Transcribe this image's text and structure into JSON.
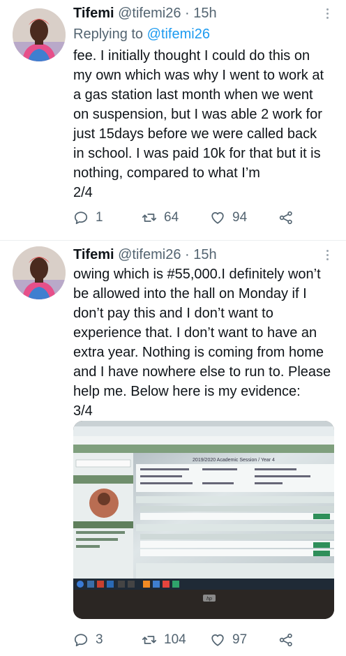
{
  "tweets": [
    {
      "author_name": "Tifemi",
      "handle": "@tifemi26",
      "separator": "·",
      "time": "15h",
      "reply_prefix": "Replying to",
      "reply_to": "@tifemi26",
      "text": "fee. I initially thought I could do this on\nmy own which was why I went to work at\na gas station last month when we went\non suspension, but I was able 2 work for\njust 15days before we were called back\nin school. I was paid 10k for that but it is\nnothing, compared to what I’m\n2/4",
      "reply_count": "1",
      "retweet_count": "64",
      "like_count": "94"
    },
    {
      "author_name": "Tifemi",
      "handle": "@tifemi26",
      "separator": "·",
      "time": "15h",
      "text": "owing which is #55,000.I definitely won’t\nbe allowed into the hall on Monday if I\ndon’t pay this and I don’t want to\nexperience that. I don’t want to have an\nextra year. Nothing is coming from home\nand I have nowhere else to run to. Please\nhelp me. Below here is my evidence:\n3/4",
      "reply_count": "3",
      "retweet_count": "104",
      "like_count": "97",
      "photo": {
        "screen_heading": "2019/2020 Academic Session / Year 4",
        "monitor_brand": "hp"
      }
    }
  ],
  "icons": [
    "reply-icon",
    "retweet-icon",
    "like-icon",
    "share-icon",
    "more-icon"
  ],
  "colors": {
    "muted": "#536471",
    "link": "#1d9bf0",
    "text": "#0f1419"
  }
}
